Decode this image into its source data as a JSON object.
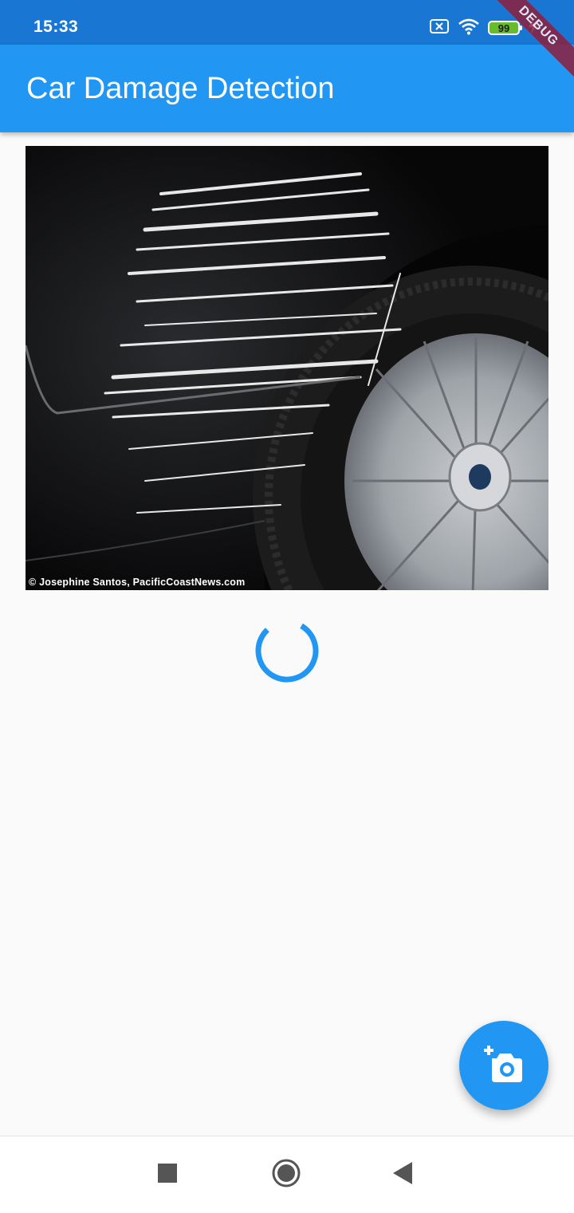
{
  "status_bar": {
    "time": "15:33",
    "battery_level": "99",
    "icons": [
      "sim-off-icon",
      "wifi-icon",
      "battery-icon",
      "charging-icon"
    ]
  },
  "debug_banner": "DEBUG",
  "app_bar": {
    "title": "Car Damage Detection"
  },
  "photo": {
    "caption": "© Josephine Santos, PacificCoastNews.com"
  },
  "loading_indicator": {
    "state": "loading"
  },
  "fab": {
    "icon": "add-a-photo-icon"
  },
  "nav_bar": {
    "buttons": [
      "recents-square-icon",
      "home-circle-icon",
      "back-triangle-icon"
    ]
  },
  "colors": {
    "primary": "#2196f3",
    "status_bar": "#1976d2",
    "background": "#fafafa",
    "debug_banner": "#8e1f3e"
  }
}
